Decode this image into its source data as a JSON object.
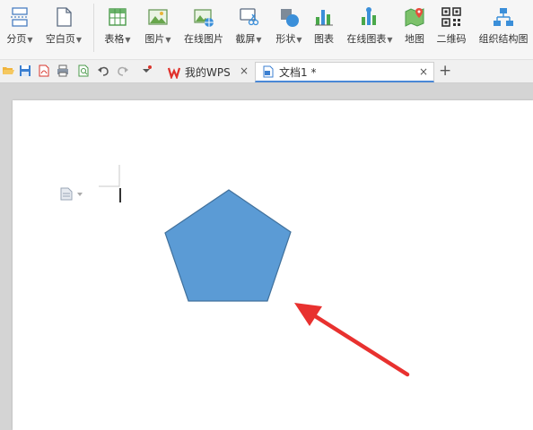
{
  "ribbon": {
    "items": [
      {
        "label": "分页",
        "icon": "page-break-icon",
        "dropdown": true
      },
      {
        "label": "空白页",
        "icon": "blank-page-icon",
        "dropdown": true
      },
      {
        "label": "表格",
        "icon": "table-icon",
        "dropdown": true
      },
      {
        "label": "图片",
        "icon": "picture-icon",
        "dropdown": true
      },
      {
        "label": "在线图片",
        "icon": "online-picture-icon",
        "dropdown": false
      },
      {
        "label": "截屏",
        "icon": "screenshot-icon",
        "dropdown": true
      },
      {
        "label": "形状",
        "icon": "shapes-icon",
        "dropdown": true
      },
      {
        "label": "图表",
        "icon": "chart-icon",
        "dropdown": false
      },
      {
        "label": "在线图表",
        "icon": "online-chart-icon",
        "dropdown": true
      },
      {
        "label": "地图",
        "icon": "map-icon",
        "dropdown": false
      },
      {
        "label": "二维码",
        "icon": "qrcode-icon",
        "dropdown": false
      },
      {
        "label": "组织结构图",
        "icon": "org-chart-icon",
        "dropdown": false
      }
    ]
  },
  "tabs": [
    {
      "label": "我的WPS",
      "icon": "wps-logo-icon",
      "close": "×"
    },
    {
      "label": "文档1 *",
      "icon": "document-icon",
      "close": "×"
    }
  ],
  "tab_add": "+",
  "colors": {
    "shape_fill": "#5b9bd5",
    "shape_stroke": "#41719c",
    "arrow": "#e8312f",
    "active_tab_underline": "#4a88d6"
  }
}
